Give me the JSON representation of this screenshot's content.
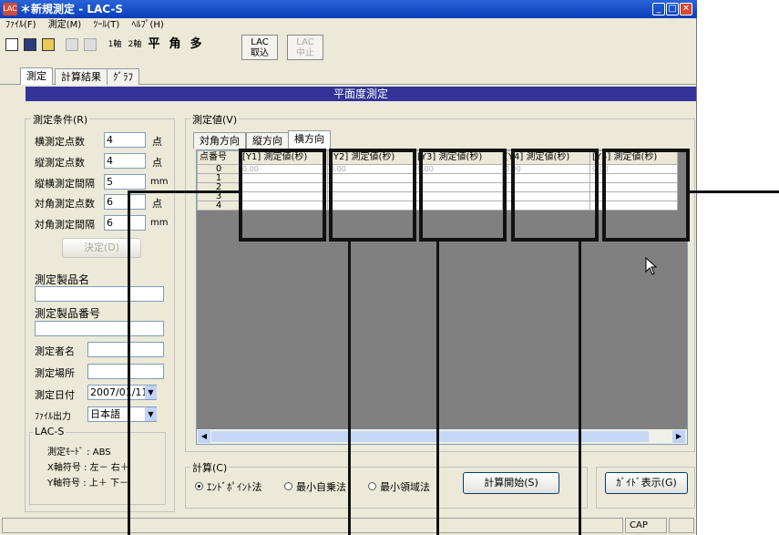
{
  "window": {
    "title": "＊新規測定 - LAC-S",
    "app_badge": "LAC"
  },
  "menu": [
    "ﾌｧｲﾙ(F)",
    "測定(M)",
    "ﾂｰﾙ(T)",
    "ﾍﾙﾌﾟ(H)"
  ],
  "toolbar": {
    "one_axis": "1軸",
    "two_axis": "2軸",
    "flat": "平",
    "angle": "角",
    "multi": "多",
    "lac_load": "LAC\n取込",
    "lac_stop": "LAC\n中止"
  },
  "main_tabs": [
    "測定",
    "計算結果",
    "ｸﾞﾗﾌ"
  ],
  "banner": "平面度測定",
  "conditions": {
    "title": "測定条件(R)",
    "rows": [
      {
        "label": "横測定点数",
        "value": "4",
        "unit": "点"
      },
      {
        "label": "縦測定点数",
        "value": "4",
        "unit": "点"
      },
      {
        "label": "縦横測定間隔",
        "value": "5",
        "unit": "mm"
      },
      {
        "label": "対角測定点数",
        "value": "6",
        "unit": "点"
      },
      {
        "label": "対角測定間隔",
        "value": "6",
        "unit": "mm"
      }
    ],
    "decide_button": "決定(D)",
    "product_name_label": "測定製品名",
    "product_number_label": "測定製品番号",
    "measurer_label": "測定者名",
    "place_label": "測定場所",
    "date_label": "測定日付",
    "date_value": "2007/01/11",
    "file_output_label": "ﾌｧｲﾙ出力",
    "file_output_value": "日本語",
    "lac_group": {
      "title": "LAC-S",
      "lines": [
        "測定ﾓｰﾄﾞ : ABS",
        "X軸符号 : 左－ 右＋",
        "Y軸符号 : 上＋ 下－"
      ]
    }
  },
  "values": {
    "title": "測定値(V)",
    "tabs": [
      "対角方向",
      "縦方向",
      "横方向"
    ],
    "columns": [
      "点番号",
      "[Y1] 測定値(秒)",
      "[Y2] 測定値(秒)",
      "[Y3] 測定値(秒)",
      "[Y4] 測定値(秒)",
      "[Y5] 測定値(秒)"
    ],
    "rows": [
      [
        "0",
        "0.00",
        "0.00",
        "0.00",
        "0.00",
        "0.00"
      ],
      [
        "1",
        "",
        "",
        "",
        "",
        ""
      ],
      [
        "2",
        "",
        "",
        "",
        "",
        ""
      ],
      [
        "3",
        "",
        "",
        "",
        "",
        ""
      ],
      [
        "4",
        "",
        "",
        "",
        "",
        ""
      ]
    ]
  },
  "calc": {
    "title": "計算(C)",
    "options": [
      "ｴﾝﾄﾞﾎﾟｲﾝﾄ法",
      "最小自乗法",
      "最小領域法"
    ],
    "selected": 0,
    "start_button": "計算開始(S)",
    "guide_button": "ｶﾞｲﾄﾞ表示(G)"
  },
  "status": {
    "cap": "CAP"
  }
}
